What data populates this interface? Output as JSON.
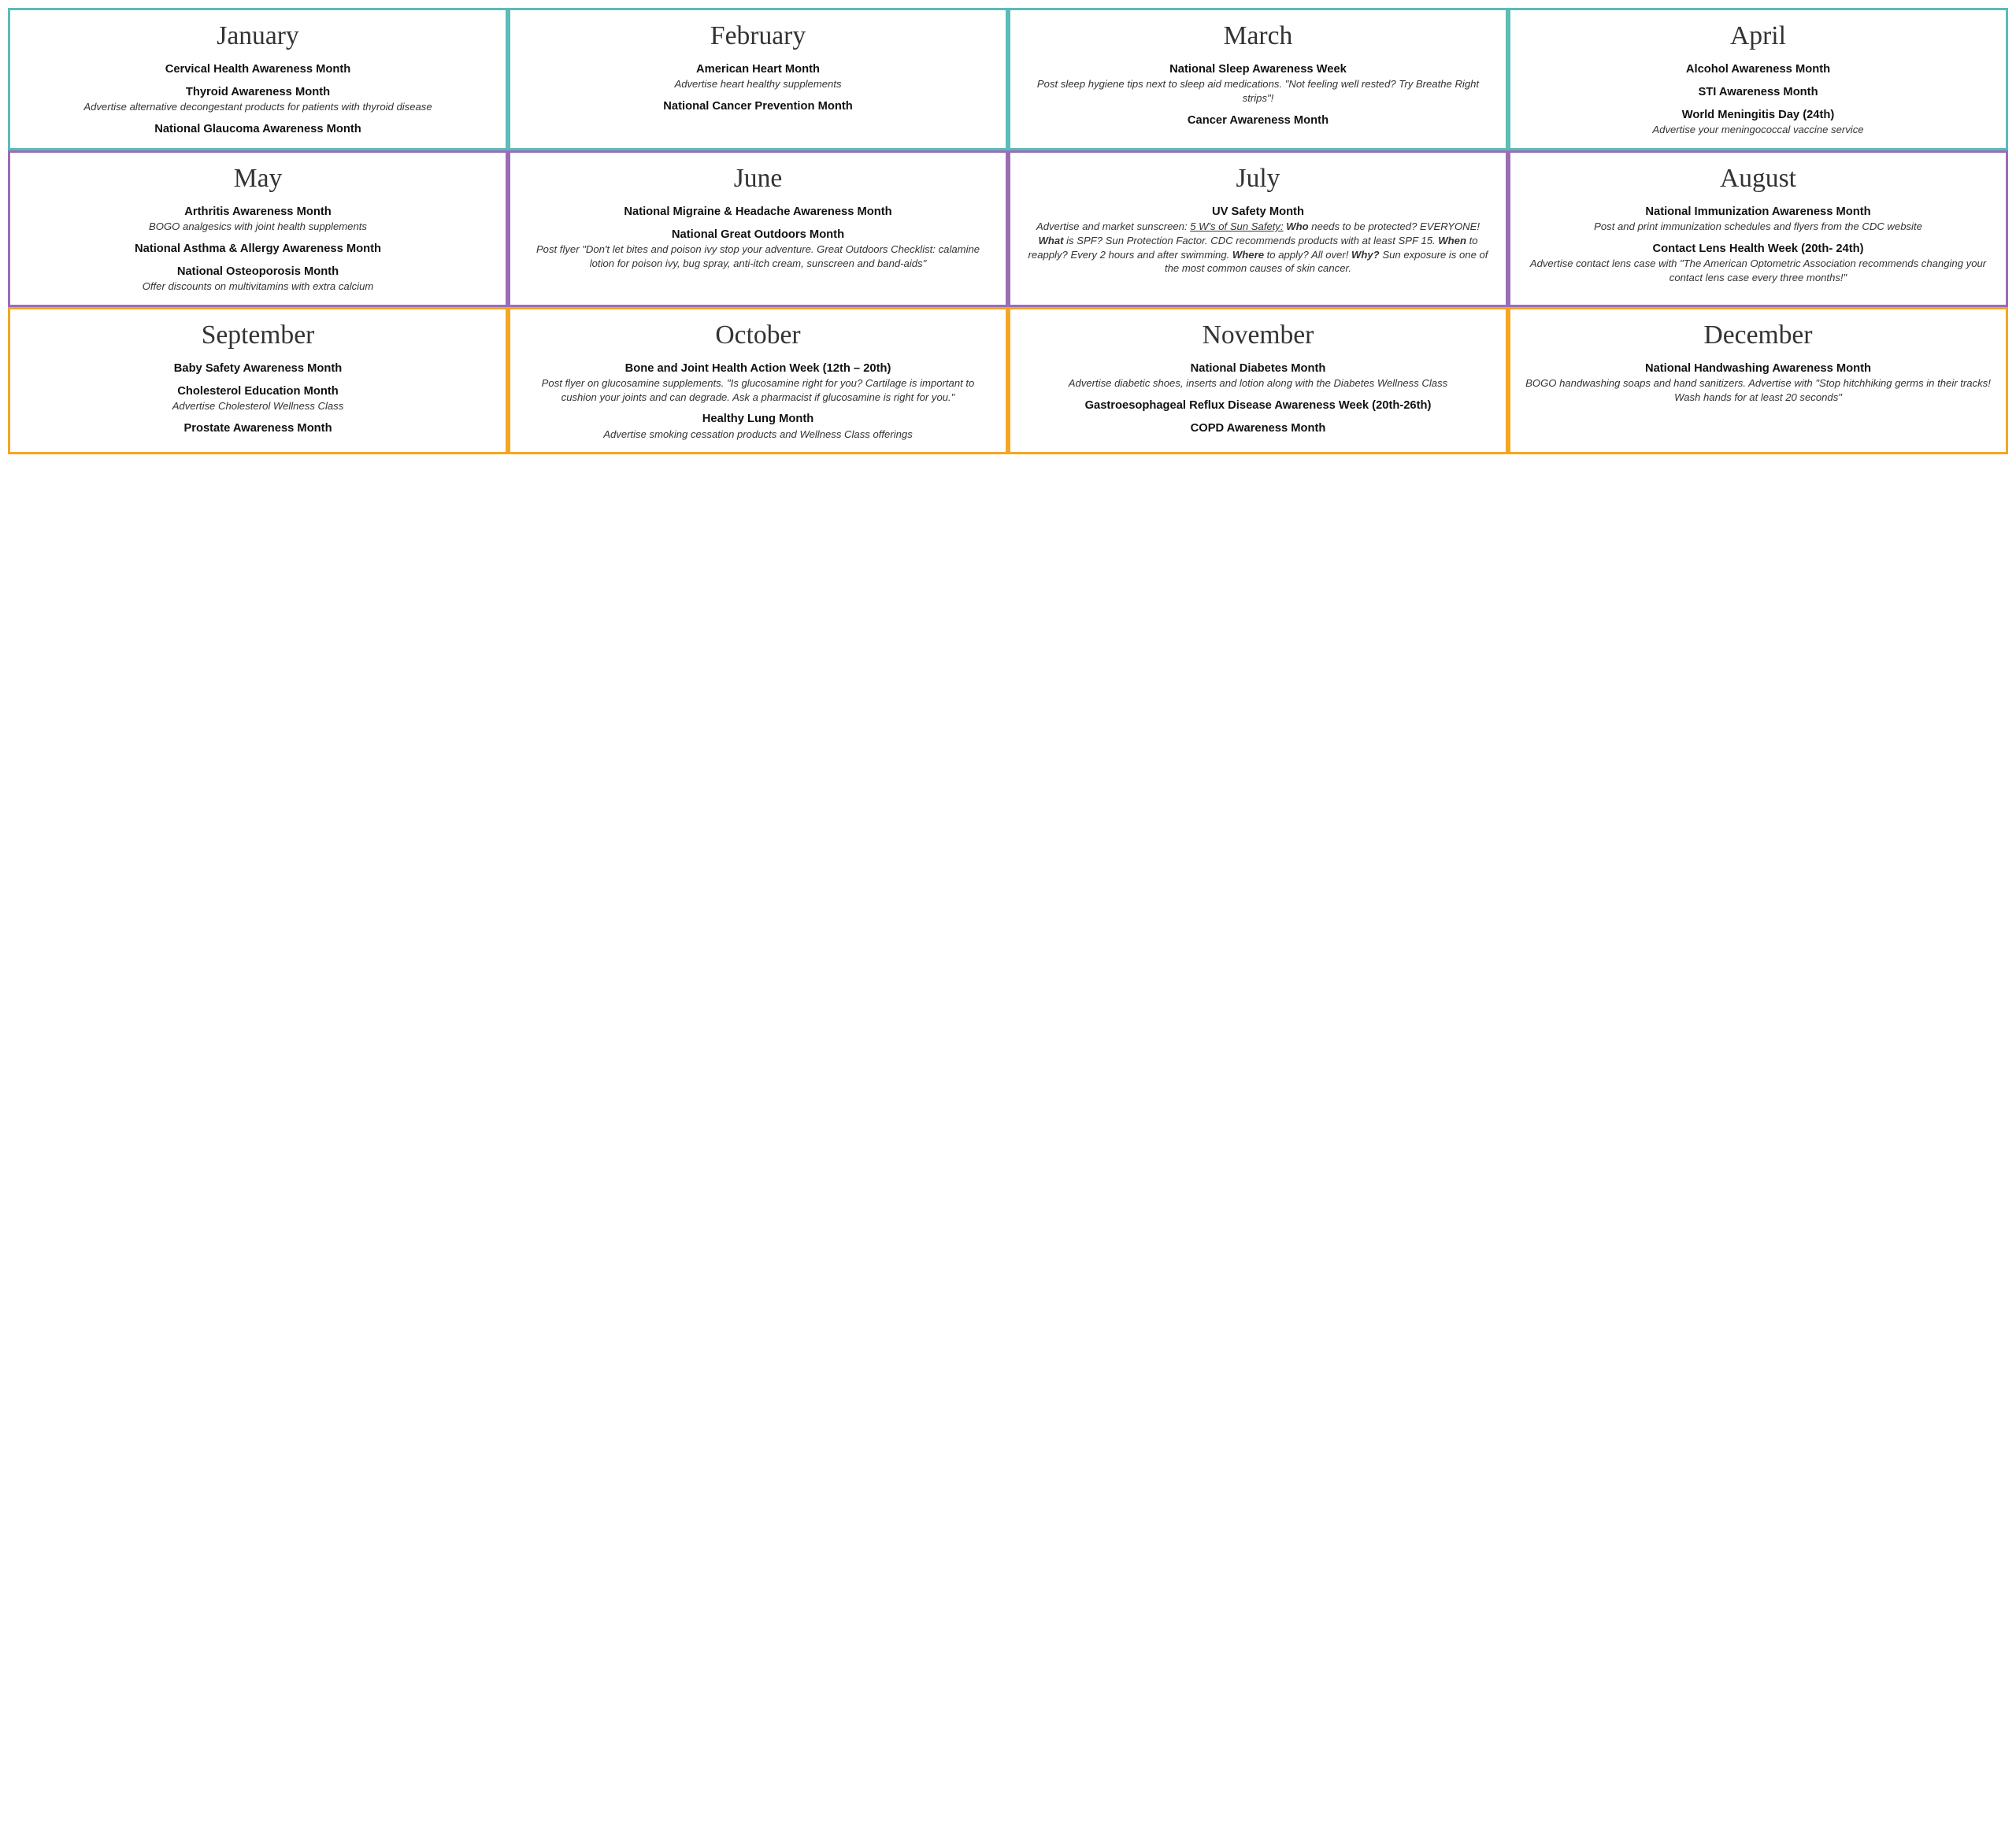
{
  "months": [
    {
      "id": "january",
      "title": "January",
      "border": "teal",
      "events": [
        {
          "title": "Cervical Health Awareness Month",
          "desc": ""
        },
        {
          "title": "Thyroid Awareness Month",
          "desc": "Advertise alternative decongestant products for patients with thyroid disease"
        },
        {
          "title": "National Glaucoma Awareness Month",
          "desc": ""
        }
      ]
    },
    {
      "id": "february",
      "title": "February",
      "border": "teal",
      "events": [
        {
          "title": "American Heart Month",
          "desc": "Advertise heart healthy supplements"
        },
        {
          "title": "National Cancer Prevention Month",
          "desc": ""
        }
      ]
    },
    {
      "id": "march",
      "title": "March",
      "border": "teal",
      "events": [
        {
          "title": "National Sleep Awareness Week",
          "desc": "Post sleep hygiene tips next to sleep aid medications. \"Not feeling well rested? Try Breathe Right strips\"!"
        },
        {
          "title": "Cancer Awareness Month",
          "desc": ""
        }
      ]
    },
    {
      "id": "april",
      "title": "April",
      "border": "teal",
      "events": [
        {
          "title": "Alcohol Awareness Month",
          "desc": ""
        },
        {
          "title": "STI Awareness Month",
          "desc": ""
        },
        {
          "title": "World Meningitis Day (24th)",
          "desc": "Advertise your meningococcal vaccine service"
        }
      ]
    },
    {
      "id": "may",
      "title": "May",
      "border": "purple",
      "events": [
        {
          "title": "Arthritis Awareness Month",
          "desc": "BOGO analgesics with joint health supplements"
        },
        {
          "title": "National Asthma & Allergy Awareness Month",
          "desc": ""
        },
        {
          "title": "National Osteoporosis Month",
          "desc": "Offer discounts on multivitamins with extra calcium"
        }
      ]
    },
    {
      "id": "june",
      "title": "June",
      "border": "purple",
      "events": [
        {
          "title": "National Migraine & Headache Awareness Month",
          "desc": ""
        },
        {
          "title": "National Great Outdoors Month",
          "desc": "Post flyer \"Don't let bites and poison ivy stop your adventure. Great Outdoors Checklist: calamine lotion for poison ivy, bug spray, anti-itch cream, sunscreen and band-aids\""
        }
      ]
    },
    {
      "id": "july",
      "title": "July",
      "border": "purple",
      "events": [
        {
          "title": "UV Safety Month",
          "desc": "Advertise and market sunscreen: 5 W's of Sun Safety: Who needs to be protected? EVERYONE! What is SPF? Sun Protection Factor. CDC recommends products with at least SPF 15. When to reapply? Every 2 hours and after swimming. Where to apply? All over! Why? Sun exposure is one of the most common causes of skin cancer."
        }
      ]
    },
    {
      "id": "august",
      "title": "August",
      "border": "purple",
      "events": [
        {
          "title": "National Immunization Awareness Month",
          "desc": "Post and print immunization schedules and flyers from the CDC website"
        },
        {
          "title": "Contact Lens Health Week (20th- 24th)",
          "desc": "Advertise contact lens case with \"The American Optometric Association recommends changing your contact lens case every three months!\""
        }
      ]
    },
    {
      "id": "september",
      "title": "September",
      "border": "orange",
      "events": [
        {
          "title": "Baby Safety Awareness Month",
          "desc": ""
        },
        {
          "title": "Cholesterol Education Month",
          "desc": "Advertise Cholesterol Wellness Class"
        },
        {
          "title": "Prostate Awareness Month",
          "desc": ""
        }
      ]
    },
    {
      "id": "october",
      "title": "October",
      "border": "orange",
      "events": [
        {
          "title": "Bone and Joint Health Action Week (12th – 20th)",
          "desc": "Post flyer on glucosamine supplements. \"Is glucosamine right for you? Cartilage is important to cushion your joints and can degrade. Ask a pharmacist if glucosamine is right for you.\""
        },
        {
          "title": "Healthy Lung Month",
          "desc": "Advertise smoking cessation products and Wellness Class offerings"
        }
      ]
    },
    {
      "id": "november",
      "title": "November",
      "border": "orange",
      "events": [
        {
          "title": "National Diabetes Month",
          "desc": "Advertise diabetic shoes, inserts and lotion along with the Diabetes Wellness Class"
        },
        {
          "title": "Gastroesophageal Reflux Disease Awareness Week (20th-26th)",
          "desc": ""
        },
        {
          "title": "COPD Awareness Month",
          "desc": ""
        }
      ]
    },
    {
      "id": "december",
      "title": "December",
      "border": "orange",
      "events": [
        {
          "title": "National Handwashing Awareness Month",
          "desc": "BOGO handwashing soaps and hand sanitizers. Advertise with \"Stop hitchhiking germs in their tracks! Wash hands for at least 20 seconds\""
        }
      ]
    }
  ]
}
